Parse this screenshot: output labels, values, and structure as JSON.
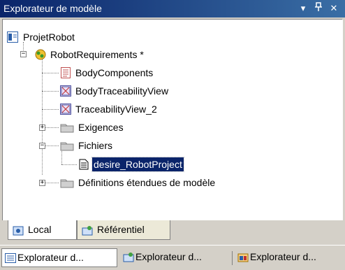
{
  "window": {
    "title": "Explorateur de modèle",
    "buttons": {
      "menu": "▾",
      "pin": "ᵖ",
      "close": "✕"
    }
  },
  "tree": {
    "root": {
      "label": "ProjetRobot",
      "icon": "project-icon"
    },
    "model": {
      "label": "RobotRequirements *",
      "icon": "model-icon",
      "expanded": true
    },
    "items": [
      {
        "label": "BodyComponents",
        "icon": "diagram-icon"
      },
      {
        "label": "BodyTraceabilityView",
        "icon": "traceability-view-icon"
      },
      {
        "label": "TraceabilityView_2",
        "icon": "traceability-view-icon"
      }
    ],
    "folders": [
      {
        "label": "Exigences",
        "expanded": false
      },
      {
        "label": "Fichiers",
        "expanded": true,
        "children": [
          {
            "label": "desire_RobotProject",
            "selected": true
          }
        ]
      },
      {
        "label": "Définitions étendues de modèle",
        "expanded": false
      }
    ]
  },
  "bottom_tabs": [
    {
      "label": "Local",
      "icon": "local-icon",
      "active": true
    },
    {
      "label": "Référentiel",
      "icon": "repository-icon",
      "active": false
    }
  ],
  "doc_tabs": [
    {
      "label": "Explorateur d...",
      "icon": "explorer-icon",
      "active": true
    },
    {
      "label": "Explorateur d...",
      "icon": "explorer-icon",
      "active": false
    },
    {
      "label": "Explorateur d...",
      "icon": "explorer-icon",
      "active": false
    }
  ],
  "colors": {
    "title_start": "#0a246a",
    "title_end": "#3a6ea5",
    "selection": "#0a246a",
    "chrome": "#d4d0c8"
  }
}
